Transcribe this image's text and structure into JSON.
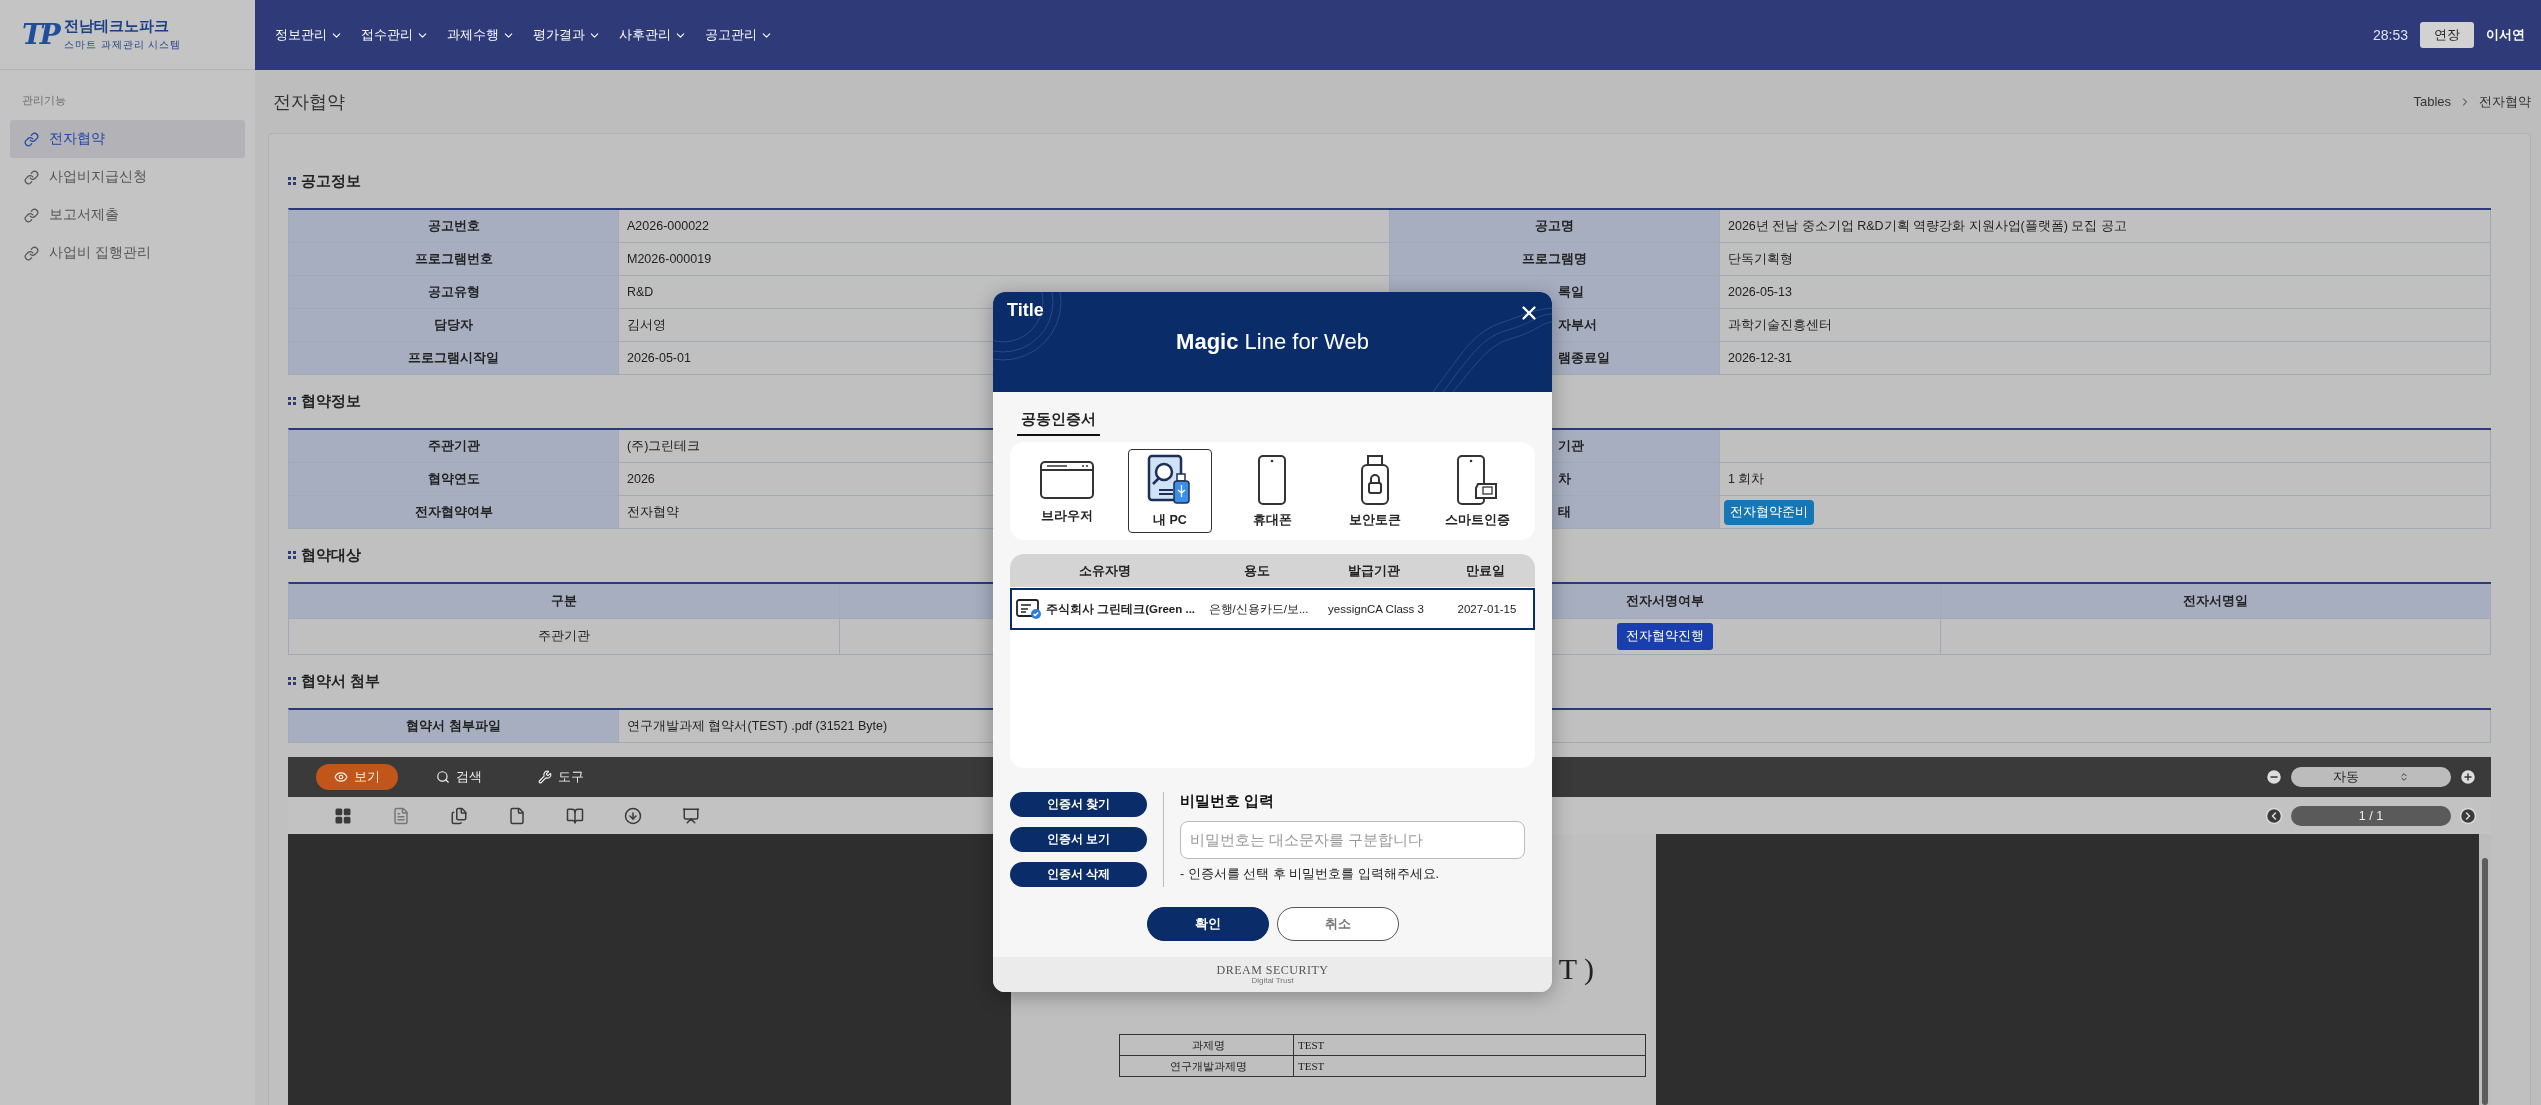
{
  "header": {
    "logo": {
      "mark": "TP",
      "name": "전남테크노파크",
      "tagline": "스마트 과제관리 시스템"
    },
    "menu": [
      {
        "label": "정보관리"
      },
      {
        "label": "접수관리"
      },
      {
        "label": "과제수행"
      },
      {
        "label": "평가결과"
      },
      {
        "label": "사후관리"
      },
      {
        "label": "공고관리"
      }
    ],
    "timer": "28:53",
    "extend_button": "연장",
    "user": "이서연"
  },
  "sidebar": {
    "heading": "관리기능",
    "items": [
      {
        "label": "전자협약",
        "selected": true
      },
      {
        "label": "사업비지급신청",
        "selected": false
      },
      {
        "label": "보고서제출",
        "selected": false
      },
      {
        "label": "사업비 집행관리",
        "selected": false
      }
    ]
  },
  "page": {
    "title": "전자협약",
    "breadcrumb": [
      "Tables",
      "전자협약"
    ]
  },
  "sections": [
    {
      "title": "공고정보",
      "kind": "form",
      "rows": [
        [
          {
            "kind": "label",
            "text": "공고번호"
          },
          {
            "kind": "value",
            "text": "A2026-000022"
          },
          {
            "kind": "label",
            "text": "공고명"
          },
          {
            "kind": "value",
            "text": "2026년 전남 중소기업 R&D기획 역량강화 지원사업(플랫폼) 모집 공고"
          }
        ],
        [
          {
            "kind": "label",
            "text": "프로그램번호"
          },
          {
            "kind": "value",
            "text": "M2026-000019"
          },
          {
            "kind": "label",
            "text": "프로그램명"
          },
          {
            "kind": "value",
            "text": "단독기획형"
          }
        ],
        [
          {
            "kind": "label",
            "text": "공고유형"
          },
          {
            "kind": "value",
            "text": "R&D"
          },
          {
            "kind": "label_partial",
            "text": "록일"
          },
          {
            "kind": "value",
            "text": "2026-05-13"
          }
        ],
        [
          {
            "kind": "label",
            "text": "담당자"
          },
          {
            "kind": "value",
            "text": "김서영"
          },
          {
            "kind": "label_partial",
            "text": "자부서"
          },
          {
            "kind": "value",
            "text": "과학기술진흥센터"
          }
        ],
        [
          {
            "kind": "label",
            "text": "프로그램시작일"
          },
          {
            "kind": "value",
            "text": "2026-05-01"
          },
          {
            "kind": "label_partial",
            "text": "램종료일"
          },
          {
            "kind": "value",
            "text": "2026-12-31"
          }
        ]
      ]
    },
    {
      "title": "협약정보",
      "kind": "form",
      "rows": [
        [
          {
            "kind": "label",
            "text": "주관기관"
          },
          {
            "kind": "value",
            "text": "(주)그린테크"
          },
          {
            "kind": "label_partial",
            "text": "기관"
          },
          {
            "kind": "empty"
          }
        ],
        [
          {
            "kind": "label",
            "text": "협약연도"
          },
          {
            "kind": "value",
            "text": "2026"
          },
          {
            "kind": "label_partial",
            "text": "차"
          },
          {
            "kind": "value",
            "text": "1 회차"
          }
        ],
        [
          {
            "kind": "label",
            "text": "전자협약여부"
          },
          {
            "kind": "value",
            "text": "전자협약"
          },
          {
            "kind": "label_partial",
            "text": "태"
          },
          {
            "kind": "status",
            "text": "전자협약준비"
          }
        ]
      ]
    },
    {
      "title": "협약대상",
      "kind": "grid",
      "columns": [
        {
          "kind": "text",
          "label": "구분"
        },
        {
          "kind": "empty"
        },
        {
          "kind": "text",
          "label": "전자서명여부"
        },
        {
          "kind": "text",
          "label": "전자서명일"
        }
      ],
      "rows": [
        [
          {
            "kind": "text",
            "text": "주관기관"
          },
          {
            "kind": "empty"
          },
          {
            "kind": "button",
            "text": "전자협약진행"
          },
          {
            "kind": "empty"
          }
        ]
      ]
    },
    {
      "title": "협약서 첨부",
      "kind": "form",
      "rows": [
        [
          {
            "kind": "label",
            "text": "협약서 첨부파일"
          },
          {
            "kind": "value",
            "text": "연구개발과제 협약서(TEST) .pdf (31521 Byte)"
          }
        ]
      ]
    }
  ],
  "viewer": {
    "tabs": [
      {
        "kind": "view",
        "label": "보기",
        "selected": true
      },
      {
        "kind": "search",
        "label": "검색",
        "selected": false
      },
      {
        "kind": "tools",
        "label": "도구",
        "selected": false
      }
    ],
    "zoom": "자동",
    "page": "1 / 1",
    "document": {
      "heading": "T )",
      "rows": [
        {
          "label": "과제명",
          "value": "TEST"
        },
        {
          "label": "연구개발과제명",
          "value": "TEST"
        }
      ]
    }
  },
  "dialog": {
    "corner_title": "Title",
    "title": "**Magic** Line for Web",
    "tabs": [
      {
        "label": "공동인증서",
        "selected": true
      }
    ],
    "devices": [
      {
        "kind": "browser",
        "label": "브라우저",
        "selected": false
      },
      {
        "kind": "pc",
        "label": "내 PC",
        "selected": true
      },
      {
        "kind": "phone",
        "label": "휴대폰",
        "selected": false
      },
      {
        "kind": "token",
        "label": "보안토큰",
        "selected": false
      },
      {
        "kind": "smart",
        "label": "스마트인증",
        "selected": false
      }
    ],
    "certificates": {
      "columns": [
        "소유자명",
        "용도",
        "발급기관",
        "만료일"
      ],
      "rows": [
        {
          "selected": true,
          "cells": [
            "주식회사 그린테크(Green ...",
            "은행/신용카드/보...",
            "yessignCA Class 3",
            "2027-01-15"
          ]
        }
      ]
    },
    "cert_buttons": [
      "인증서 찾기",
      "인증서 보기",
      "인증서 삭제"
    ],
    "password": {
      "heading": "비밀번호 입력",
      "placeholder": "비밀번호는 대소문자를 구분합니다",
      "hint": "- 인증서를 선택 후 비밀번호를 입력해주세요."
    },
    "buttons": [
      {
        "kind": "primary",
        "label": "확인"
      },
      {
        "kind": "secondary",
        "label": "취소"
      }
    ],
    "brand": {
      "name": "DREAM SECURITY",
      "tagline": "Digital Trust"
    }
  }
}
